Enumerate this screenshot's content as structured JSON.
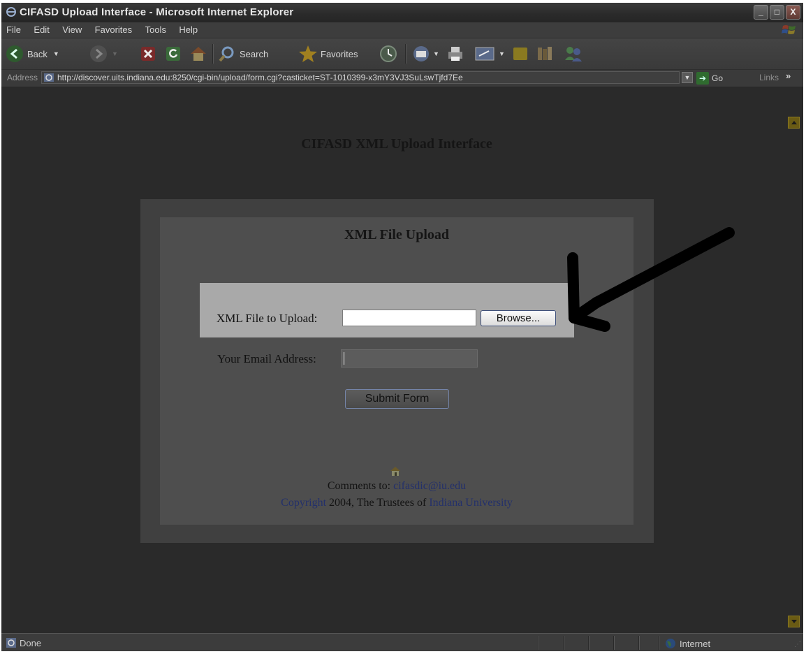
{
  "window": {
    "title": "CIFASD Upload Interface - Microsoft Internet Explorer",
    "controls": {
      "minimize": "_",
      "maximize": "□",
      "close": "X"
    }
  },
  "menu": [
    "File",
    "Edit",
    "View",
    "Favorites",
    "Tools",
    "Help"
  ],
  "toolbar": {
    "back_label": "Back",
    "search_label": "Search",
    "favorites_label": "Favorites"
  },
  "address_bar": {
    "label": "Address",
    "url": "http://discover.uits.indiana.edu:8250/cgi-bin/upload/form.cgi?casticket=ST-1010399-x3mY3VJ3SuLswTjfd7Ee",
    "go_label": "Go",
    "links_label": "Links",
    "links_chevron": "»"
  },
  "page": {
    "title": "CIFASD XML Upload Interface",
    "panel_title": "XML File Upload",
    "file_label": "XML File to Upload:",
    "file_value": "",
    "browse_label": "Browse...",
    "email_label": "Your Email Address:",
    "email_value": "",
    "submit_label": "Submit Form",
    "comments_prefix": "Comments to:",
    "comments_email": "cifasdic@iu.edu",
    "copyright_link": "Copyright",
    "copyright_text": "2004, The Trustees of",
    "university_link": "Indiana University"
  },
  "status_bar": {
    "status": "Done",
    "zone": "Internet"
  },
  "colors": {
    "content_bg": "#2a2a2a",
    "highlight_row": "#a9a9a9",
    "link": "#23306b",
    "scroll_button": "#6a5b14"
  }
}
